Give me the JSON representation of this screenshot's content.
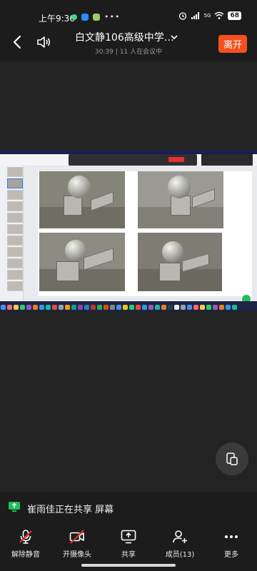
{
  "status_bar": {
    "time": "上午9:36",
    "signal_label": "5G",
    "battery": "68"
  },
  "header": {
    "title": "白文静106高级中学…",
    "elapsed": "30:39",
    "participants_text": "11 人在会议中",
    "leave_label": "离开"
  },
  "share_bar": {
    "text": "崔雨佳正在共享 屏幕"
  },
  "toolbar": {
    "items": [
      {
        "label": "解除静音",
        "icon": "mic-off-icon"
      },
      {
        "label": "开摄像头",
        "icon": "camera-off-icon"
      },
      {
        "label": "共享",
        "icon": "share-screen-icon"
      },
      {
        "label": "成员(13)",
        "icon": "add-member-icon"
      },
      {
        "label": "更多",
        "icon": "more-icon"
      }
    ]
  },
  "colors": {
    "leave": "#f5511d",
    "share_green": "#1fbf5a",
    "muted_red": "#e1332a"
  }
}
